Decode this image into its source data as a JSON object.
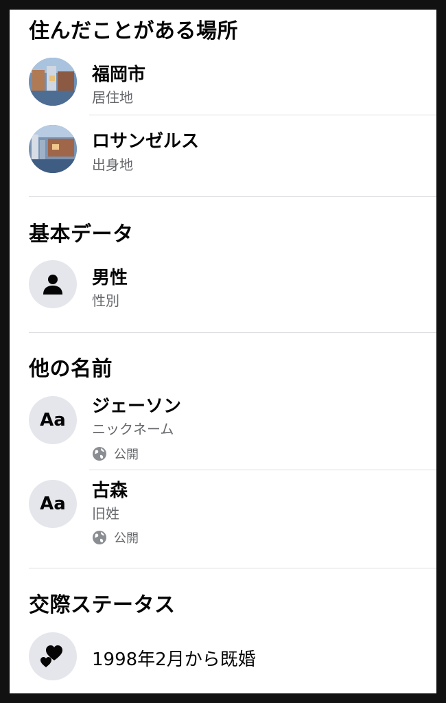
{
  "places": {
    "title": "住んだことがある場所",
    "items": [
      {
        "name": "福岡市",
        "sub": "居住地"
      },
      {
        "name": "ロサンゼルス",
        "sub": "出身地"
      }
    ]
  },
  "basic": {
    "title": "基本データ",
    "gender": {
      "value": "男性",
      "label": "性別"
    }
  },
  "other_names": {
    "title": "他の名前",
    "items": [
      {
        "name": "ジェーソン",
        "sub": "ニックネーム",
        "privacy": "公開",
        "icon_text": "Aa"
      },
      {
        "name": "古森",
        "sub": "旧姓",
        "privacy": "公開",
        "icon_text": "Aa"
      }
    ]
  },
  "relationship": {
    "title": "交際ステータス",
    "value": "1998年2月から既婚"
  },
  "colors": {
    "primary_text": "#050505",
    "secondary_text": "#65676b",
    "icon_bg": "#e4e6eb",
    "divider": "#dadde1"
  },
  "icons": {
    "gender": "person-icon",
    "other_names": "aa-text-icon",
    "privacy": "globe-icon",
    "relationship": "hearts-icon"
  }
}
